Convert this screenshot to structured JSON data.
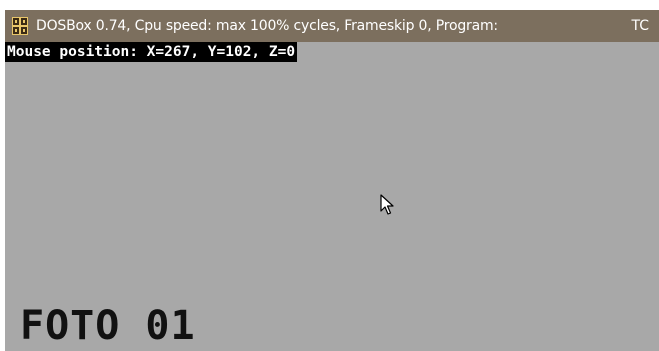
{
  "window": {
    "title": "DOSBox 0.74, Cpu speed: max 100% cycles, Frameskip  0, Program:",
    "title_right": "TC",
    "icon": "dosbox-icon"
  },
  "screen": {
    "status_text": "Mouse position: X=267, Y=102, Z=0",
    "label": "FOTO 01",
    "cursor_icon": "mouse-pointer-icon"
  },
  "colors": {
    "titlebar": "#7c6f5e",
    "screen_background": "#a8a8a8",
    "status_background": "#000000",
    "status_text": "#ffffff",
    "label_text": "#111111"
  }
}
